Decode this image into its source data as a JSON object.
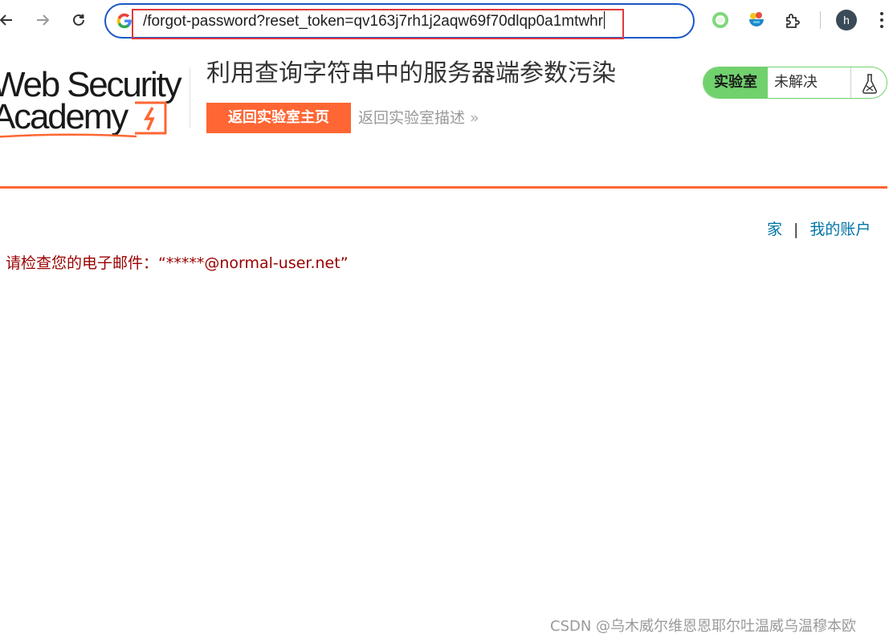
{
  "browser": {
    "url": "/forgot-password?reset_token=qv163j7rh1j2aqw69f70dlqp0a1mtwhr",
    "avatar_letter": "h",
    "icons": [
      "back-arrow-icon",
      "forward-arrow-icon",
      "reload-icon",
      "google-g-icon",
      "extension-ring-icon",
      "extension-bowl-icon",
      "puzzle-extensions-icon",
      "more-vert-icon"
    ],
    "highlight_color": "#e0393e"
  },
  "header": {
    "logo_line1": "Web Security",
    "logo_line2": "Academy",
    "lab_title": "利用查询字符串中的服务器端参数污染",
    "back_home_button": "返回实验室主页",
    "back_description_link": "返回实验室描述",
    "back_description_chevron": "»",
    "status_label": "实验室",
    "status_value": "未解决",
    "status_icon": "flask-icon"
  },
  "nav": {
    "home": "家",
    "separator": "|",
    "my_account": "我的账户"
  },
  "content": {
    "notice": "请检查您的电子邮件：“*****@normal-user.net”"
  },
  "watermark": "CSDN @乌木威尔维恩恩耶尔吐温威乌温穆本欧",
  "colors": {
    "accent": "#ff6633",
    "status_green": "#70d16d",
    "link": "#0073a8",
    "notice": "#990000",
    "omnibox_border": "#1a57c6"
  }
}
